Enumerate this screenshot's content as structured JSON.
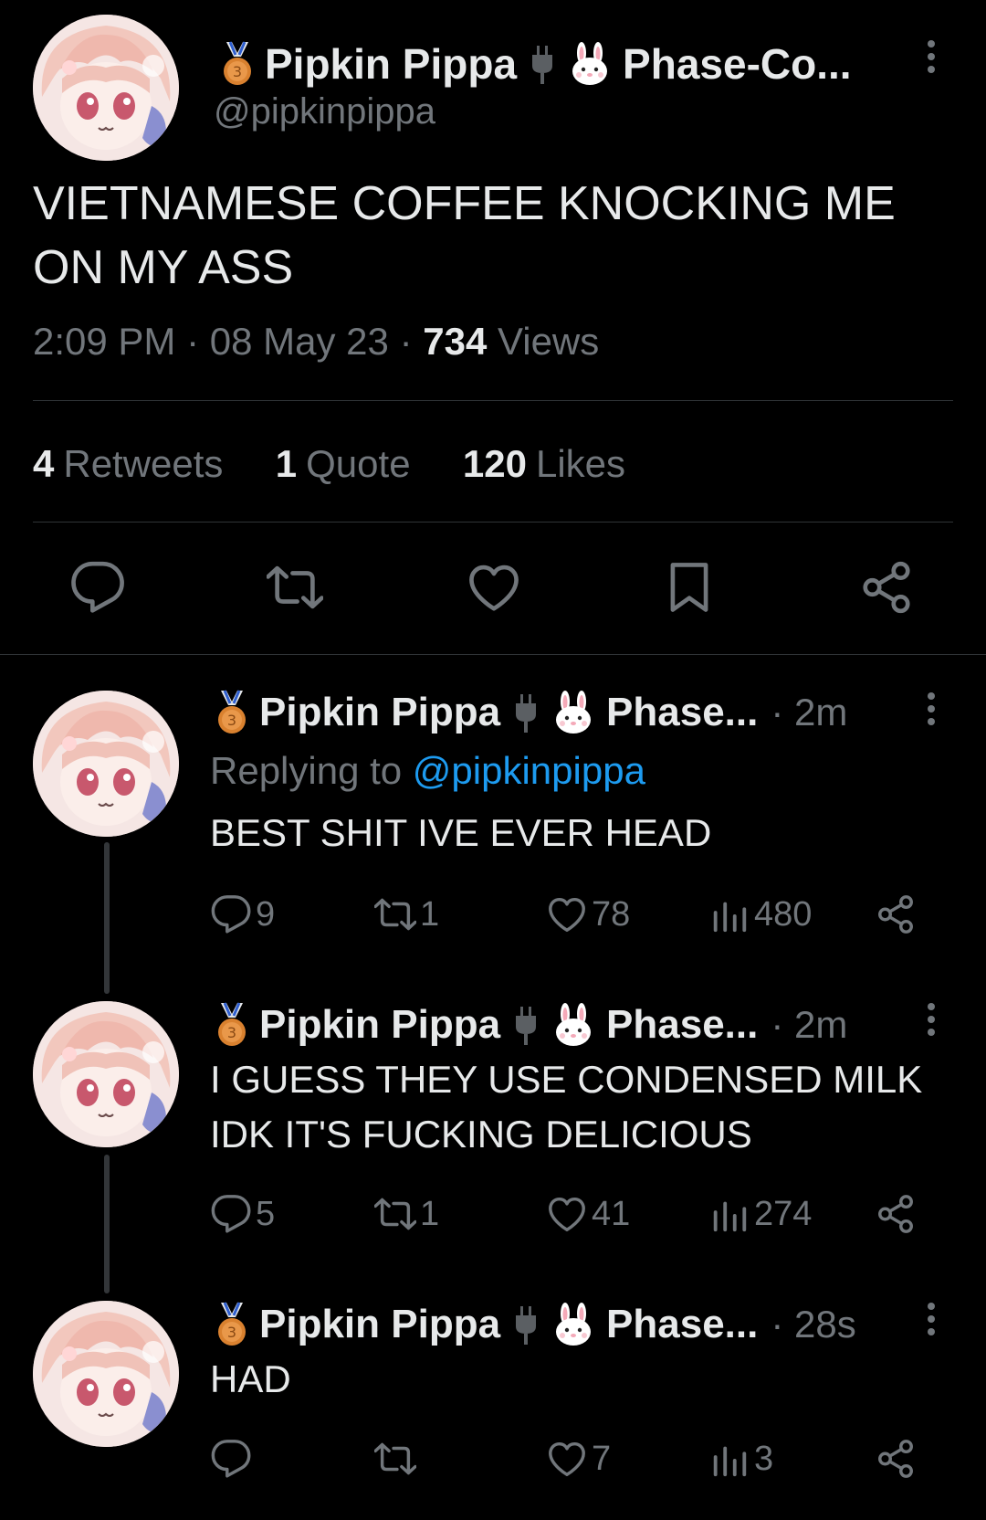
{
  "main_tweet": {
    "display_name": "Pipkin Pippa",
    "name_suffix": "Phase-Co...",
    "handle": "@pipkinpippa",
    "text": "VIETNAMESE COFFEE KNOCKING ME ON MY ASS",
    "time": "2:09 PM",
    "date": "08 May 23",
    "views_count": "734",
    "views_label": "Views",
    "retweets_count": "4",
    "retweets_label": "Retweets",
    "quotes_count": "1",
    "quotes_label": "Quote",
    "likes_count": "120",
    "likes_label": "Likes",
    "sep": "·"
  },
  "replies": [
    {
      "display_name": "Pipkin Pippa",
      "name_suffix": "Phase...",
      "time": "2m",
      "replying_prefix": "Replying to",
      "replying_handle": "@pipkinpippa",
      "text": "BEST SHIT IVE EVER HEAD",
      "replies": "9",
      "retweets": "1",
      "likes": "78",
      "views": "480"
    },
    {
      "display_name": "Pipkin Pippa",
      "name_suffix": "Phase...",
      "time": "2m",
      "text": "I GUESS THEY USE CONDENSED MILK IDK IT'S FUCKING DELICIOUS",
      "replies": "5",
      "retweets": "1",
      "likes": "41",
      "views": "274"
    },
    {
      "display_name": "Pipkin Pippa",
      "name_suffix": "Phase...",
      "time": "28s",
      "text": "HAD",
      "replies": "",
      "retweets": "",
      "likes": "7",
      "views": "3"
    }
  ],
  "colors": {
    "background": "#000000",
    "text_primary": "#e7e9ea",
    "text_secondary": "#71767b",
    "link": "#1d9bf0",
    "divider": "#2f3336"
  },
  "icons": [
    "bronze-medal-icon",
    "plug-icon",
    "bunny-icon",
    "more-icon",
    "reply-icon",
    "retweet-icon",
    "like-icon",
    "bookmark-icon",
    "share-icon",
    "views-icon"
  ]
}
